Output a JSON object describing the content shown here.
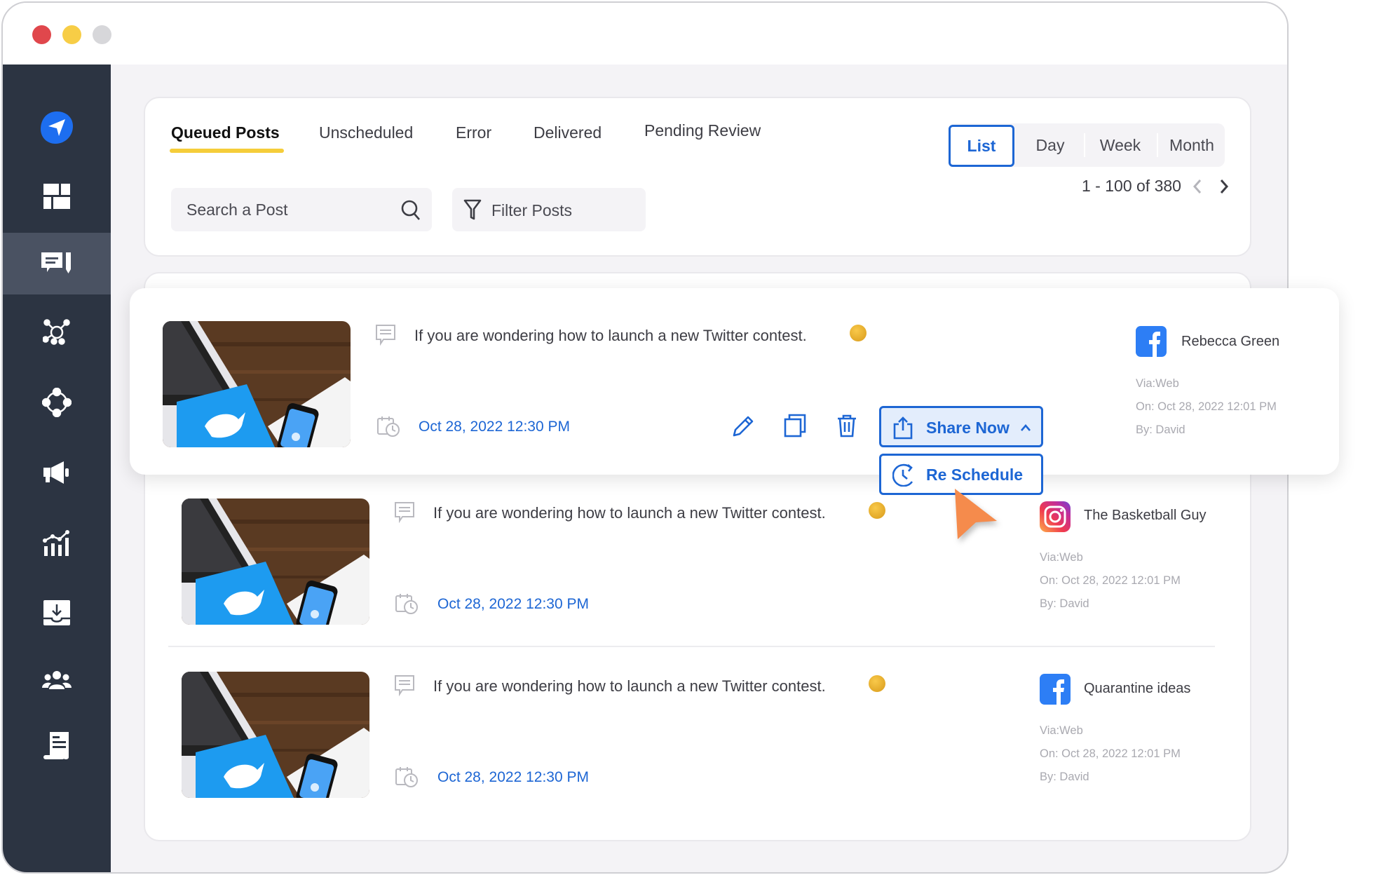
{
  "window": {
    "controls": [
      "close",
      "minimize",
      "maximize"
    ]
  },
  "sidebar": {
    "items": [
      {
        "name": "send-logo-icon",
        "active": false
      },
      {
        "name": "dashboard-icon",
        "active": false
      },
      {
        "name": "posts-icon",
        "active": true
      },
      {
        "name": "network-icon",
        "active": false
      },
      {
        "name": "connections-icon",
        "active": false
      },
      {
        "name": "megaphone-icon",
        "active": false
      },
      {
        "name": "analytics-icon",
        "active": false
      },
      {
        "name": "inbox-download-icon",
        "active": false
      },
      {
        "name": "team-icon",
        "active": false
      },
      {
        "name": "report-icon",
        "active": false
      }
    ]
  },
  "tabs": [
    {
      "label": "Queued Posts",
      "active": true
    },
    {
      "label": "Unscheduled",
      "active": false
    },
    {
      "label": "Error",
      "active": false
    },
    {
      "label": "Delivered",
      "active": false
    },
    {
      "label": "Pending Review",
      "active": false
    }
  ],
  "search": {
    "placeholder": "Search a Post"
  },
  "filter": {
    "label": "Filter Posts"
  },
  "views": [
    {
      "label": "List",
      "active": true
    },
    {
      "label": "Day",
      "active": false
    },
    {
      "label": "Week",
      "active": false
    },
    {
      "label": "Month",
      "active": false
    }
  ],
  "pagination": {
    "label": "1 - 100 of 380"
  },
  "colors": {
    "accent": "#1d66d4",
    "tab_underline": "#f5cd3a",
    "sidebar": "#2c3442",
    "cursor": "#f58b4c"
  },
  "posts": [
    {
      "text": "If you are wondering how to launch a new Twitter contest.",
      "emoji": "star-struck",
      "scheduled": "Oct 28, 2022 12:30 PM",
      "network": "facebook",
      "account": "Rebecca Green",
      "via": "Via:Web",
      "on": "On: Oct 28, 2022 12:01 PM",
      "by": "By: David"
    },
    {
      "text": "If you are wondering how to launch a new Twitter contest.",
      "emoji": "star-struck",
      "scheduled": "Oct 28, 2022 12:30 PM",
      "network": "instagram",
      "account": "The Basketball Guy",
      "via": "Via:Web",
      "on": "On: Oct 28, 2022 12:01 PM",
      "by": "By: David"
    },
    {
      "text": "If you are wondering how to launch a new Twitter contest.",
      "emoji": "star-struck",
      "scheduled": "Oct 28, 2022 12:30 PM",
      "network": "facebook",
      "account": "Quarantine ideas",
      "via": "Via:Web",
      "on": "On: Oct 28, 2022 12:01 PM",
      "by": "By: David"
    }
  ],
  "actions": {
    "share_now": "Share Now",
    "reschedule": "Re Schedule"
  }
}
